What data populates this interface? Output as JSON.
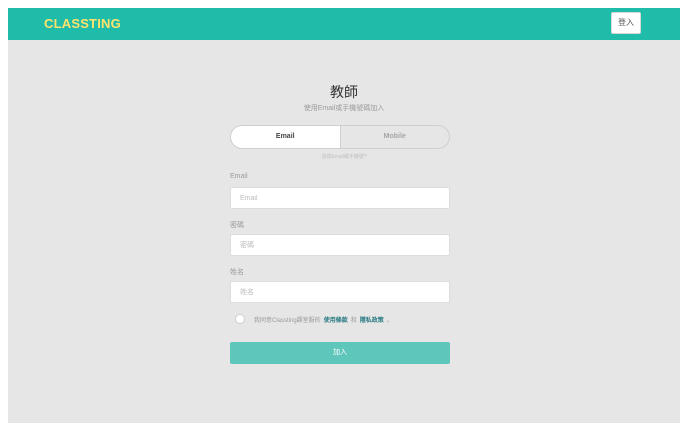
{
  "header": {
    "logo": "CLASSTING",
    "login_label": "登入"
  },
  "form": {
    "title": "教師",
    "subtitle": "使用Email或手機號碼加入",
    "tabs": [
      {
        "label": "Email",
        "active": true
      },
      {
        "label": "Mobile",
        "active": false
      }
    ],
    "help_link": "沒有Email或手機號?",
    "fields": {
      "email": {
        "label": "Email",
        "placeholder": "Email",
        "value": ""
      },
      "password": {
        "label": "密碼",
        "placeholder": "密碼",
        "value": ""
      },
      "name": {
        "label": "姓名",
        "placeholder": "姓名",
        "value": ""
      }
    },
    "agreement": {
      "prefix": "我同意Classting課室服的",
      "terms": "使用條款",
      "and": "和",
      "privacy": "隱私政策",
      "suffix": "。",
      "checked": false
    },
    "submit_label": "加入"
  },
  "colors": {
    "brand": "#1fbca9",
    "logo": "#ffe36e",
    "submit": "#5fc6bb",
    "link": "#2b7b84",
    "background": "#e6e6e6"
  }
}
